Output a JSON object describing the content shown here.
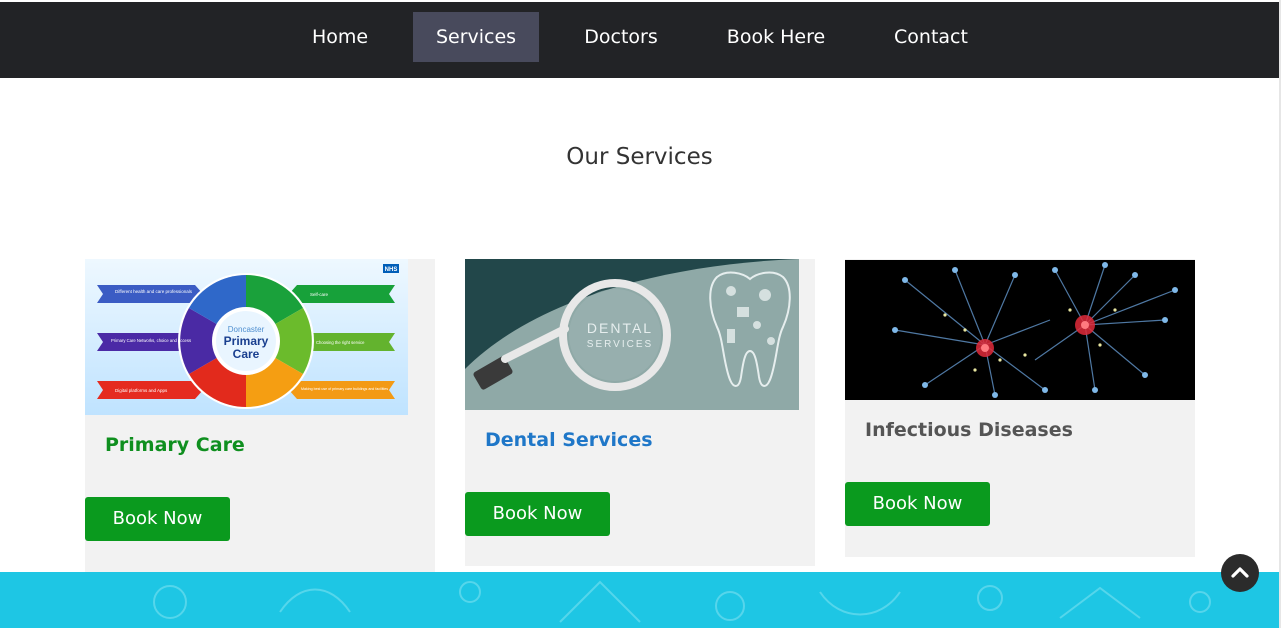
{
  "nav": {
    "items": [
      {
        "label": "Home"
      },
      {
        "label": "Services"
      },
      {
        "label": "Doctors"
      },
      {
        "label": "Book Here"
      },
      {
        "label": "Contact"
      }
    ],
    "active": "Services"
  },
  "services": {
    "title": "Our Services",
    "cards": [
      {
        "title": "Primary Care",
        "title_color": "#0f8f1f",
        "button": "Book Now",
        "image": {
          "badge": "NHS",
          "center_line1": "Doncaster",
          "center_line2": "Primary",
          "center_line3": "Care",
          "labels": [
            "Different health and care professionals",
            "Self-care",
            "Primary Care Networks, choice and access",
            "Choosing the right service",
            "Digital platforms and Apps",
            "Making best use of primary care buildings and facilities"
          ]
        }
      },
      {
        "title": "Dental Services",
        "title_color": "#1f77c8",
        "button": "Book Now",
        "image": {
          "line1": "DENTAL",
          "line2": "SERVICES"
        }
      },
      {
        "title": "Infectious Diseases",
        "title_color": "#555555",
        "button": "Book Now"
      }
    ]
  },
  "colors": {
    "navbar": "#222326",
    "nav_active": "#484a5c",
    "button": "#0a9a1e",
    "footer": "#1ec6e4"
  },
  "icons": {
    "scroll_top": "chevron-up-icon"
  }
}
